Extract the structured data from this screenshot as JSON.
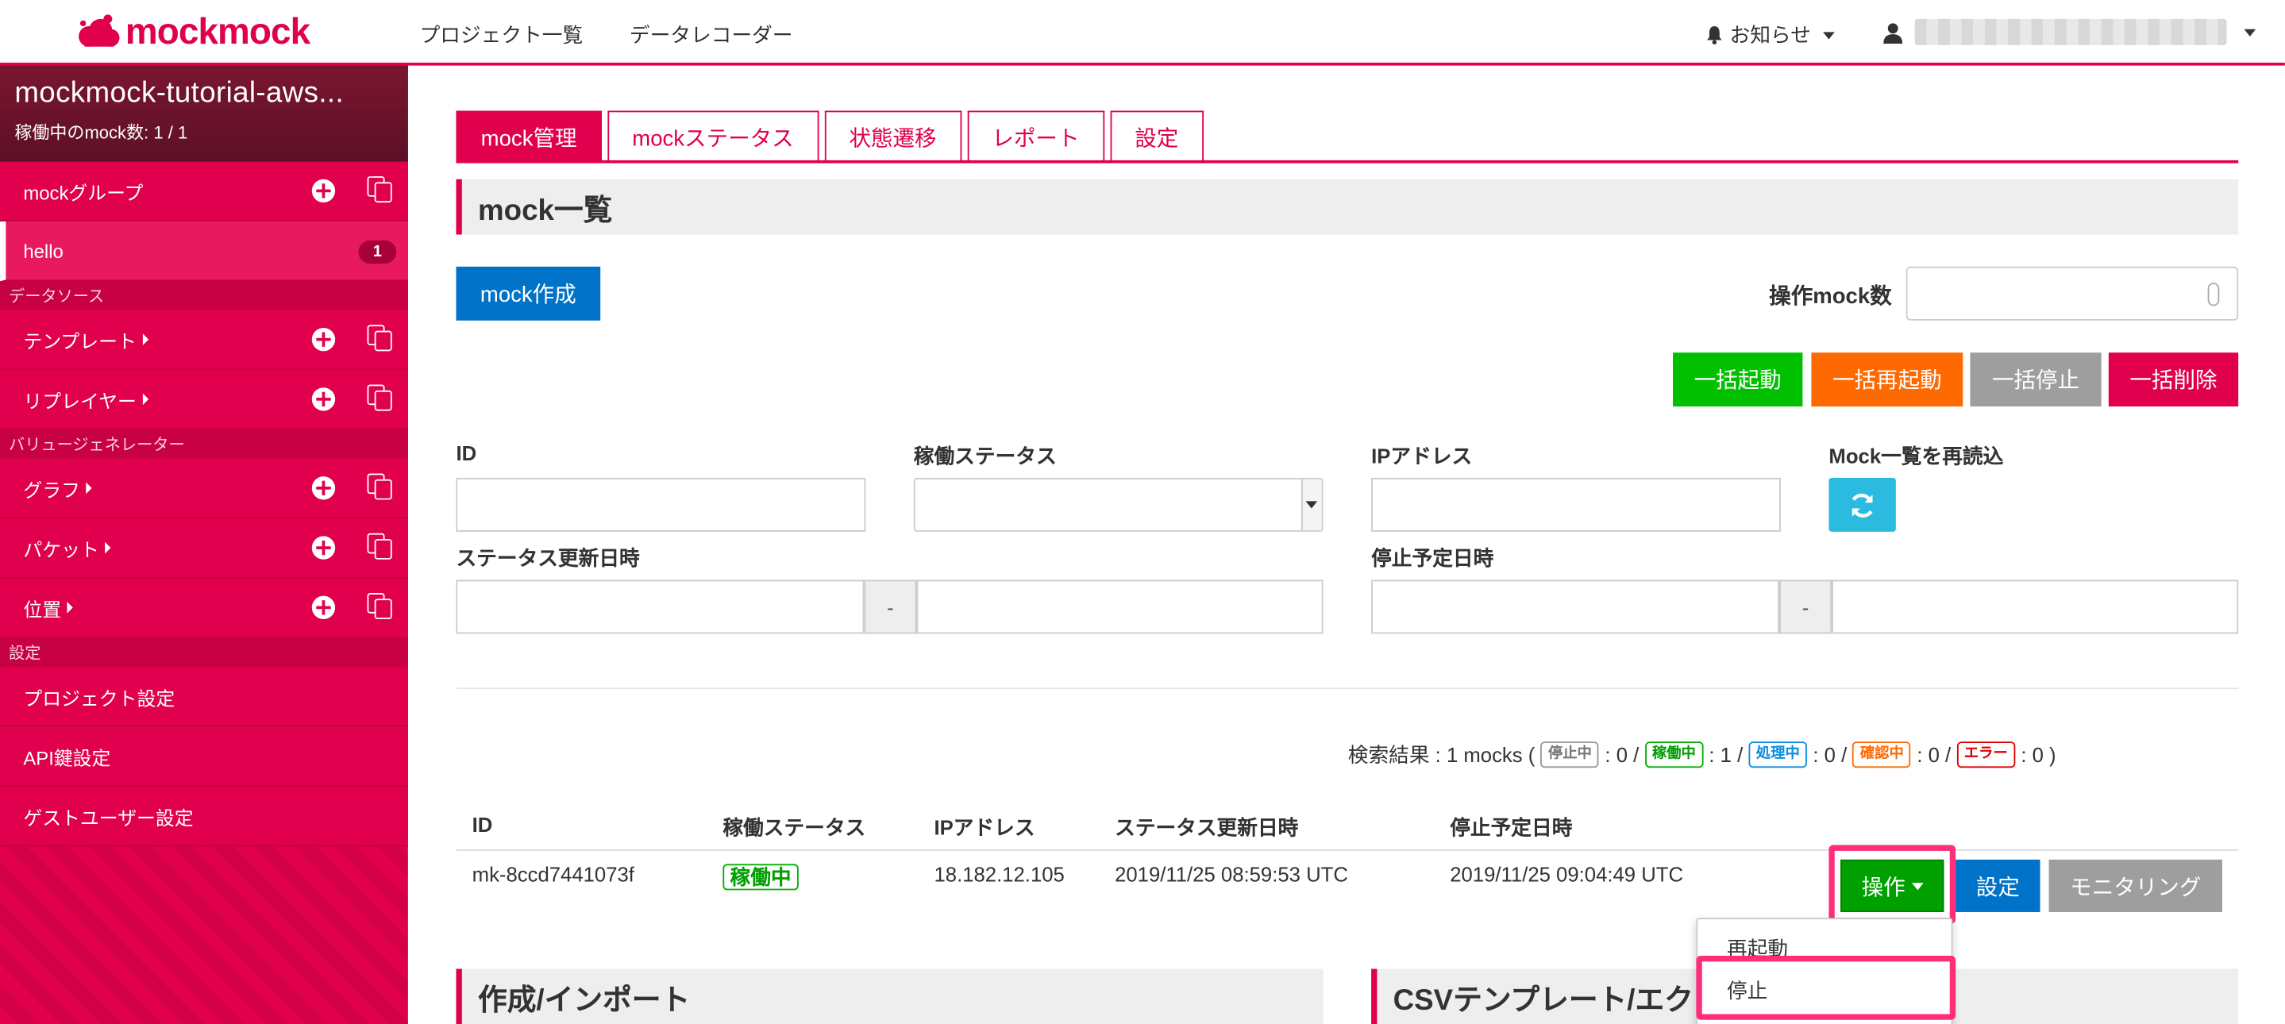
{
  "app": {
    "logo_text": "mockmock"
  },
  "topnav": {
    "projects": "プロジェクト一覧",
    "data_recorder": "データレコーダー",
    "notifications": "お知らせ"
  },
  "sidebar": {
    "project_name": "mockmock-tutorial-aws...",
    "running_count": "稼働中のmock数: 1 / 1",
    "mock_group": "mockグループ",
    "hello": {
      "label": "hello",
      "count": "1"
    },
    "datasource_header": "データソース",
    "template": "テンプレート",
    "replayer": "リプレイヤー",
    "value_gen_header": "バリュージェネレーター",
    "graph": "グラフ",
    "packet": "パケット",
    "location": "位置",
    "settings_header": "設定",
    "project_settings": "プロジェクト設定",
    "api_key_settings": "API鍵設定",
    "guest_user_settings": "ゲストユーザー設定"
  },
  "tabs": [
    "mock管理",
    "mockステータス",
    "状態遷移",
    "レポート",
    "設定"
  ],
  "main": {
    "section_title": "mock一覧",
    "create_button": "mock作成",
    "op_count_label": "操作mock数",
    "bulk": {
      "start": "一括起動",
      "restart": "一括再起動",
      "stop": "一括停止",
      "delete": "一括削除"
    },
    "filters": {
      "id": "ID",
      "status": "稼働ステータス",
      "ip": "IPアドレス",
      "reload": "Mock一覧を再読込",
      "status_updated": "ステータス更新日時",
      "stop_scheduled": "停止予定日時",
      "range_sep": "-"
    },
    "results": {
      "prefix": "検索結果 : 1 mocks (",
      "stopped_tag": "停止中",
      "stopped": ": 0 /",
      "running_tag": "稼働中",
      "running": ": 1 /",
      "processing_tag": "処理中",
      "processing": ": 0 /",
      "confirming_tag": "確認中",
      "confirming": ": 0 /",
      "error_tag": "エラー",
      "error": ": 0 )"
    },
    "table": {
      "headers": [
        "ID",
        "稼働ステータス",
        "IPアドレス",
        "ステータス更新日時",
        "停止予定日時"
      ],
      "row": {
        "id": "mk-8ccd7441073f",
        "status": "稼働中",
        "ip": "18.182.12.105",
        "updated": "2019/11/25 08:59:53 UTC",
        "stop_at": "2019/11/25 09:04:49 UTC"
      },
      "actions": {
        "operate": "操作",
        "settings": "設定",
        "monitoring": "モニタリング"
      }
    },
    "dropdown": [
      "再起動",
      "停止"
    ],
    "bottom_left_title": "作成/インポート",
    "bottom_right_title": "CSVテンプレート/エク"
  },
  "colors": {
    "brand": "#e0004d",
    "start": "#00c000",
    "restart": "#ff6a00",
    "stop": "#9e9e9e",
    "delete": "#e0004d",
    "create": "#0073c8",
    "reload": "#2bbbe0"
  }
}
